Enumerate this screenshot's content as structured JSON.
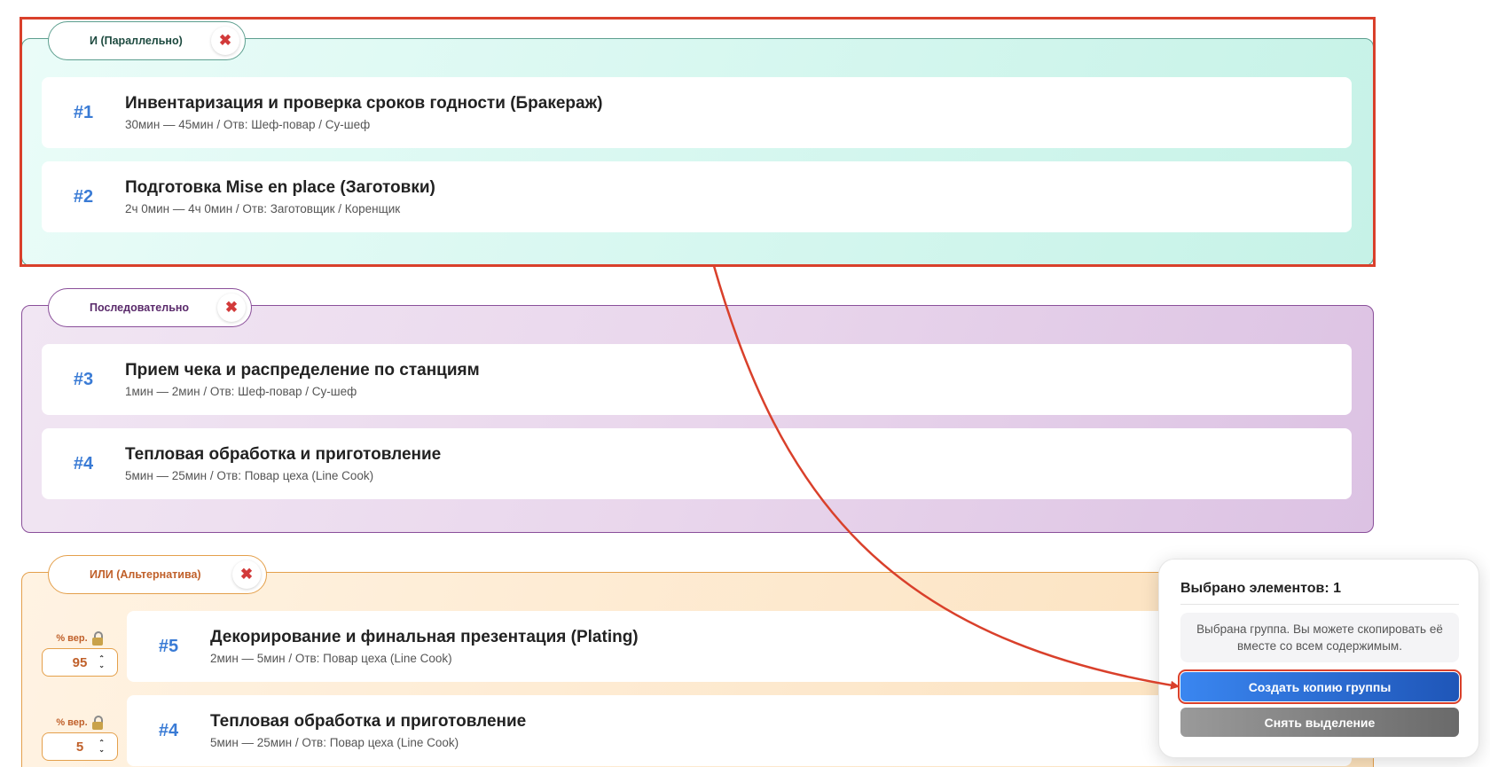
{
  "groups": {
    "parallel": {
      "label": "И (Параллельно)",
      "close_icon": "✖",
      "items": [
        {
          "num": "#1",
          "title": "Инвентаризация и проверка сроков годности (Бракераж)",
          "sub": "30мин — 45мин / Отв: Шеф-повар / Су-шеф"
        },
        {
          "num": "#2",
          "title": "Подготовка Mise en place (Заготовки)",
          "sub": "2ч 0мин — 4ч 0мин / Отв: Заготовщик / Коренщик"
        }
      ]
    },
    "sequential": {
      "label": "Последовательно",
      "close_icon": "✖",
      "items": [
        {
          "num": "#3",
          "title": "Прием чека и распределение по станциям",
          "sub": "1мин — 2мин / Отв: Шеф-повар / Су-шеф"
        },
        {
          "num": "#4",
          "title": "Тепловая обработка и приготовление",
          "sub": "5мин — 25мин / Отв: Повар цеха (Line Cook)"
        }
      ]
    },
    "alternative": {
      "label": "ИЛИ (Альтернатива)",
      "close_icon": "✖",
      "prob_label": "% вер.",
      "items": [
        {
          "num": "#5",
          "title": "Декорирование и финальная презентация (Plating)",
          "sub": "2мин — 5мин / Отв: Повар цеха (Line Cook)",
          "prob": "95"
        },
        {
          "num": "#4",
          "title": "Тепловая обработка и приготовление",
          "sub": "5мин — 25мин / Отв: Повар цеха (Line Cook)",
          "prob": "5"
        }
      ]
    }
  },
  "panel": {
    "title": "Выбрано элементов: 1",
    "info": "Выбрана группа. Вы можете скопировать её вместе со всем содержимым.",
    "copy_button": "Создать копию группы",
    "clear_button": "Снять выделение"
  },
  "colors": {
    "accent_blue": "#3a7bd5",
    "highlight_red": "#d9402b",
    "parallel_border": "#5d9f8f",
    "sequential_border": "#8a4f9a",
    "alternative_border": "#e4a04c"
  }
}
